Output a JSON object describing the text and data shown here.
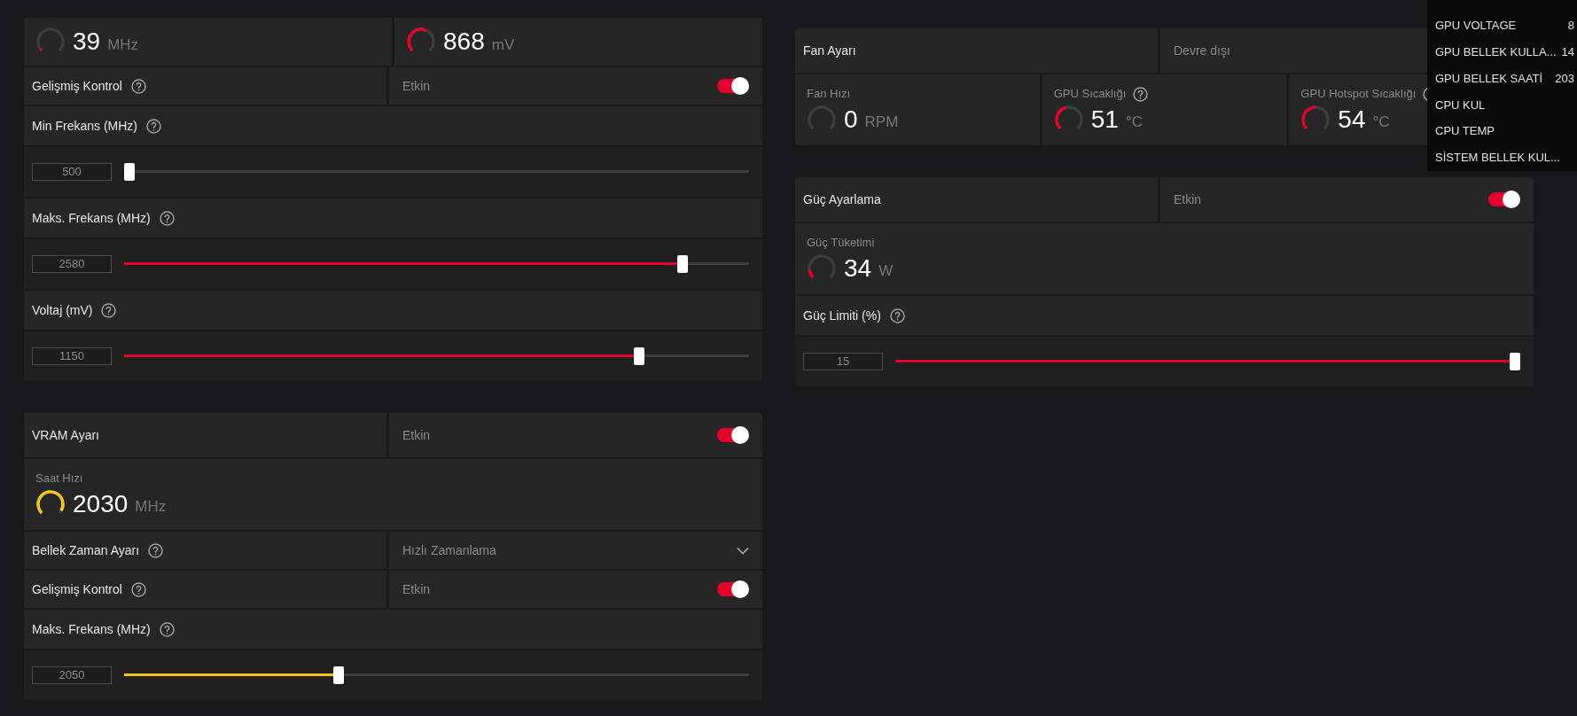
{
  "left_column": [
    {
      "rows": [
        {
          "kind": "gauges",
          "items": [
            {
              "value": "39",
              "unit": "MHz",
              "level": 0.03,
              "color": "#e4002b"
            },
            {
              "value": "868",
              "unit": "mV",
              "level": 0.6,
              "color": "#e4002b"
            }
          ]
        },
        {
          "kind": "toggle",
          "label": "Gelişmiş Kontrol",
          "help": true,
          "status": "Etkin",
          "on": true
        },
        {
          "kind": "header",
          "label": "Min Frekans (MHz)",
          "help": true
        },
        {
          "kind": "slider",
          "value": "500",
          "level": 0.0
        },
        {
          "kind": "header",
          "label": "Maks. Frekans (MHz)",
          "help": true
        },
        {
          "kind": "slider",
          "value": "2580",
          "level": 0.9,
          "color": "#e4002b"
        },
        {
          "kind": "header",
          "label": "Voltaj (mV)",
          "help": true
        },
        {
          "kind": "slider",
          "value": "1150",
          "level": 0.83,
          "color": "#e4002b"
        }
      ]
    },
    {
      "rows": [
        {
          "kind": "toggle",
          "label": "VRAM Ayarı",
          "status": "Etkin",
          "on": true
        },
        {
          "kind": "gauges",
          "items": [
            {
              "caption": "Saat Hızı",
              "value": "2030",
              "unit": "MHz",
              "level": 0.95,
              "color": "#f5c518"
            }
          ]
        },
        {
          "kind": "dropdown",
          "label": "Bellek Zaman Ayarı",
          "help": true,
          "value": "Hızlı Zamanlama"
        },
        {
          "kind": "toggle",
          "label": "Gelişmiş Kontrol",
          "help": true,
          "status": "Etkin",
          "on": true
        },
        {
          "kind": "header",
          "label": "Maks. Frekans (MHz)",
          "help": true
        },
        {
          "kind": "slider",
          "value": "2050",
          "level": 0.34,
          "color": "#f5c518"
        }
      ]
    }
  ],
  "right_column": [
    {
      "rows": [
        {
          "kind": "status",
          "label": "Fan Ayarı",
          "status": "Devre dışı"
        },
        {
          "kind": "gauges",
          "items": [
            {
              "caption": "Fan Hızı",
              "value": "0",
              "unit": "RPM",
              "level": 0
            },
            {
              "caption": "GPU Sıcaklığı",
              "help": true,
              "value": "51",
              "unit": "°C",
              "level": 0.45,
              "color": "#e4002b"
            },
            {
              "caption": "GPU Hotspot Sıcaklığı",
              "help": true,
              "value": "54",
              "unit": "°C",
              "level": 0.5,
              "color": "#e4002b"
            }
          ]
        }
      ]
    },
    {
      "rows": [
        {
          "kind": "toggle",
          "label": "Güç Ayarlama",
          "status": "Etkin",
          "on": true
        },
        {
          "kind": "gauges",
          "items": [
            {
              "caption": "Güç Tüketimi",
              "value": "34",
              "unit": "W",
              "level": 0.15,
              "color": "#e4002b"
            }
          ]
        },
        {
          "kind": "header",
          "label": "Güç Limiti (%)",
          "help": true
        },
        {
          "kind": "slider",
          "value": "15",
          "level": 1.0,
          "color": "#e4002b"
        }
      ]
    }
  ],
  "overlay": [
    {
      "label": "GPU VOLTAGE",
      "value": "8"
    },
    {
      "label": "GPU BELLEK KULLA...",
      "value": "14"
    },
    {
      "label": "GPU BELLEK SAATİ",
      "value": "203"
    },
    {
      "label": "CPU KUL"
    },
    {
      "label": "CPU TEMP"
    },
    {
      "label": "SİSTEM BELLEK KUL..."
    }
  ]
}
